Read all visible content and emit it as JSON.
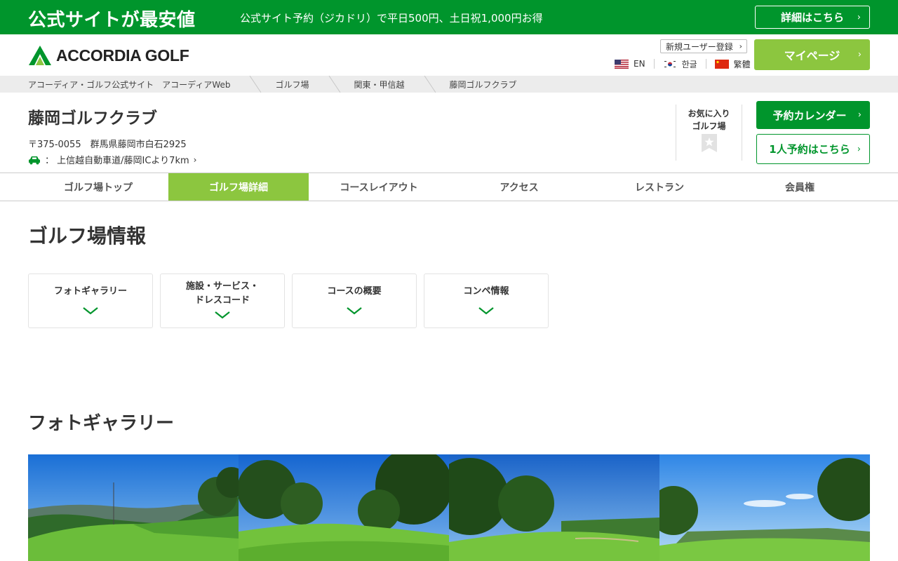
{
  "promo": {
    "title": "公式サイトが最安値",
    "text": "公式サイト予約（ジカドリ）で平日500円、土日祝1,000円お得",
    "button": "詳細はこちら"
  },
  "header": {
    "logo_text": "ACCORDIA GOLF",
    "register": "新規ユーザー登録",
    "languages": [
      {
        "code": "us-flag-icon",
        "label": "EN"
      },
      {
        "code": "kr-flag-icon",
        "label": "한글"
      },
      {
        "code": "cn-flag-icon",
        "label": "繁體"
      }
    ],
    "mypage": "マイページ"
  },
  "breadcrumb": [
    "アコーディア・ゴルフ公式サイト　アコーディアWeb",
    "ゴルフ場",
    "関東・甲信越",
    "藤岡ゴルフクラブ"
  ],
  "club": {
    "name": "藤岡ゴルフクラブ",
    "address": "〒375-0055　群馬県藤岡市白石2925",
    "access": "上信越自動車道/藤岡ICより7km",
    "favorite_line1": "お気に入り",
    "favorite_line2": "ゴルフ場",
    "calendar_button": "予約カレンダー",
    "single_button": "1人予約はこちら"
  },
  "nav": {
    "tabs": [
      "ゴルフ場トップ",
      "ゴルフ場詳細",
      "コースレイアウト",
      "アクセス",
      "レストラン",
      "会員権"
    ],
    "active_index": 1
  },
  "info": {
    "title": "ゴルフ場情報",
    "cards": [
      {
        "line1": "フォトギャラリー",
        "line2": ""
      },
      {
        "line1": "施設・サービス・",
        "line2": "ドレスコード"
      },
      {
        "line1": "コースの概要",
        "line2": ""
      },
      {
        "line1": "コンペ情報",
        "line2": ""
      }
    ]
  },
  "gallery": {
    "title": "フォトギャラリー"
  },
  "colors": {
    "brand_green": "#00952c",
    "light_green": "#8cc63f"
  }
}
